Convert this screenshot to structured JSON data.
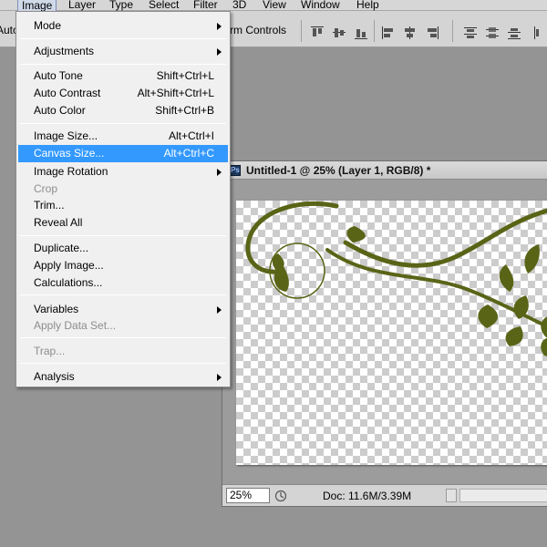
{
  "menubar": {
    "items": [
      "Image",
      "Layer",
      "Type",
      "Select",
      "Filter",
      "3D",
      "View",
      "Window",
      "Help"
    ]
  },
  "options_bar": {
    "auto_label": "Auto",
    "transform_label": "rm Controls"
  },
  "image_menu": {
    "mode": "Mode",
    "adjustments": "Adjustments",
    "auto_tone": "Auto Tone",
    "auto_tone_shortcut": "Shift+Ctrl+L",
    "auto_contrast": "Auto Contrast",
    "auto_contrast_shortcut": "Alt+Shift+Ctrl+L",
    "auto_color": "Auto Color",
    "auto_color_shortcut": "Shift+Ctrl+B",
    "image_size": "Image Size...",
    "image_size_shortcut": "Alt+Ctrl+I",
    "canvas_size": "Canvas Size...",
    "canvas_size_shortcut": "Alt+Ctrl+C",
    "image_rotation": "Image Rotation",
    "crop": "Crop",
    "trim": "Trim...",
    "reveal_all": "Reveal All",
    "duplicate": "Duplicate...",
    "apply_image": "Apply Image...",
    "calculations": "Calculations...",
    "variables": "Variables",
    "apply_data_set": "Apply Data Set...",
    "trap": "Trap...",
    "analysis": "Analysis"
  },
  "document": {
    "ps_badge": "Ps",
    "title": "Untitled-1 @ 25% (Layer 1, RGB/8) *",
    "zoom": "25%",
    "doc_size": "Doc: 11.6M/3.39M",
    "swirl_color": "#5a6417"
  }
}
